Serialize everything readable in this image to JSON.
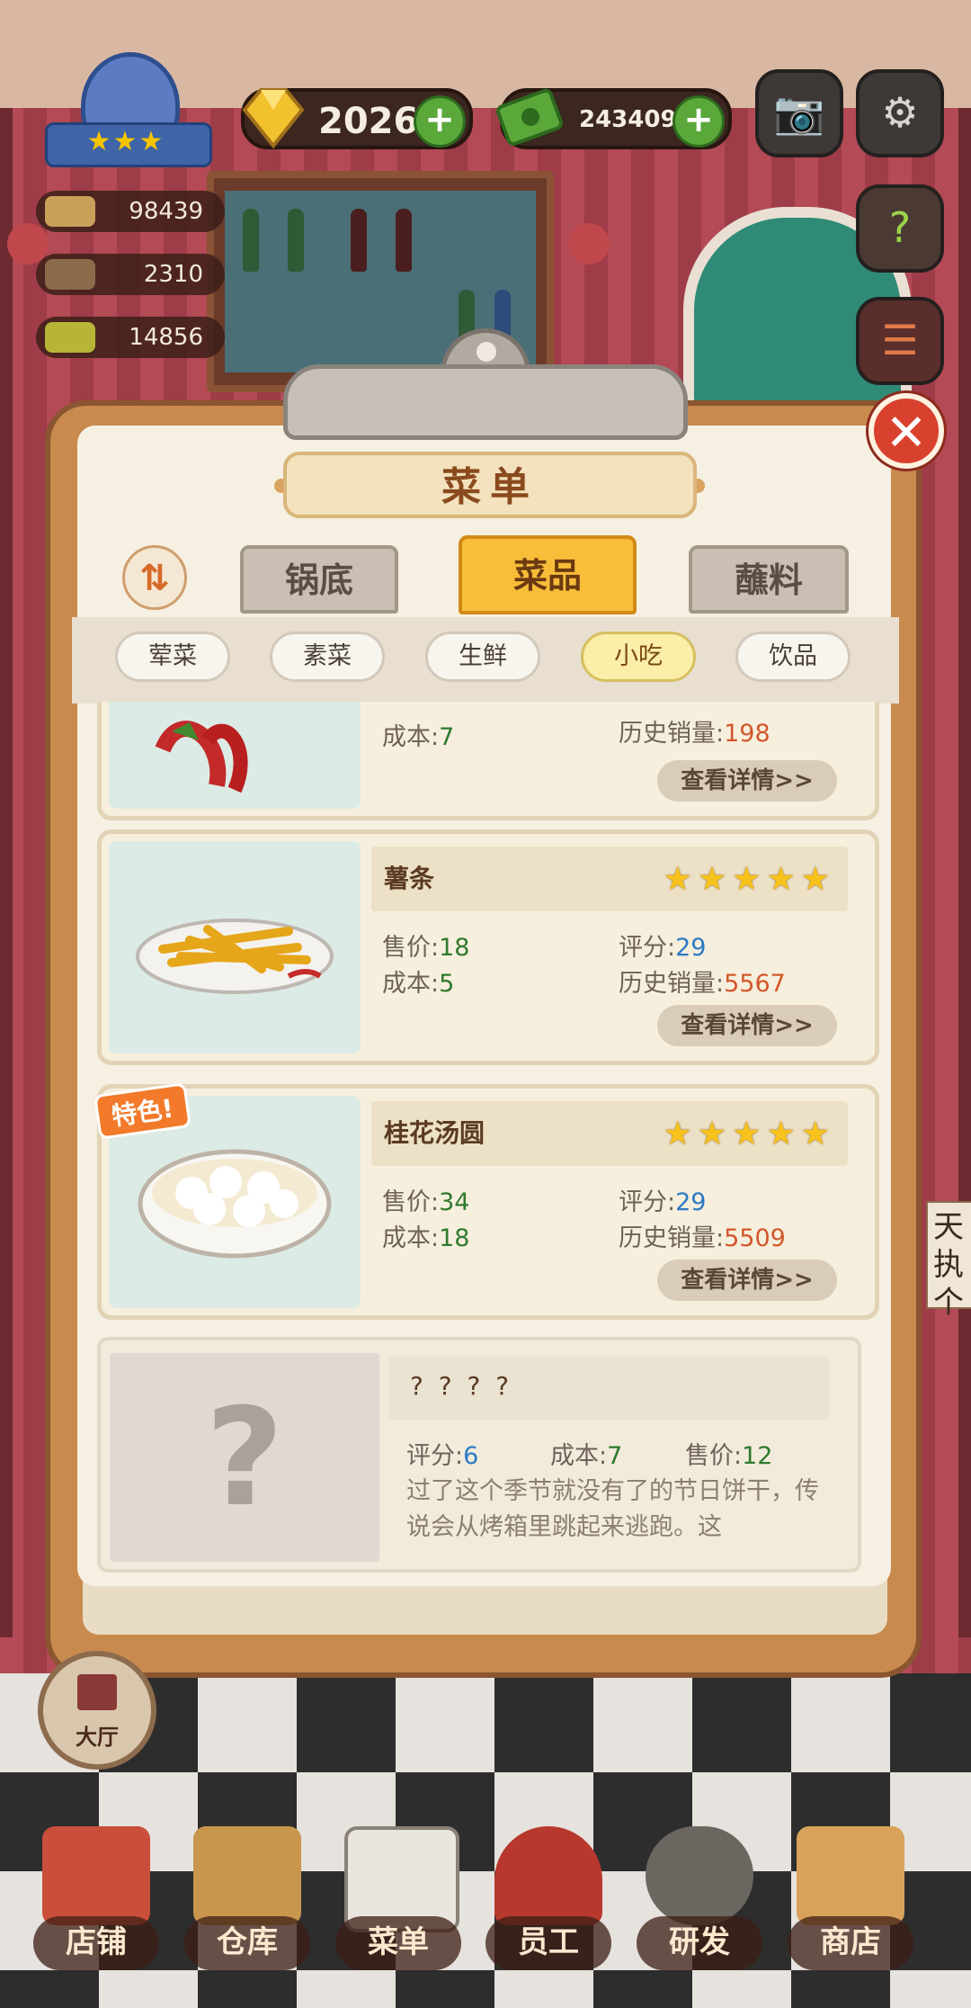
{
  "hud": {
    "gems": "2026",
    "cash": "24340991",
    "stat_1": "98439",
    "stat_2": "2310",
    "stat_3": "14856",
    "plus_symbol": "+",
    "level_stars": "★★★"
  },
  "icons": {
    "camera": "camera-icon",
    "settings": "gear-icon",
    "help": "help-book-icon",
    "recipe": "recipe-book-icon",
    "close": "close-icon",
    "sort": "sort-icon"
  },
  "menu": {
    "title": "菜单",
    "close_symbol": "✕",
    "sort_symbol": "⇅",
    "main_tabs": [
      {
        "label": "锅底",
        "active": false
      },
      {
        "label": "菜品",
        "active": true
      },
      {
        "label": "蘸料",
        "active": false
      }
    ],
    "sub_tabs": [
      {
        "label": "荤菜",
        "active": false
      },
      {
        "label": "素菜",
        "active": false
      },
      {
        "label": "生鲜",
        "active": false
      },
      {
        "label": "小吃",
        "active": true
      },
      {
        "label": "饮品",
        "active": false
      }
    ],
    "labels": {
      "price": "售价",
      "cost": "成本",
      "rating": "评分",
      "sales": "历史销量",
      "details": "查看详情>>",
      "sep": ":"
    },
    "dishes": [
      {
        "name": "",
        "price": "",
        "cost": "7",
        "rating": "",
        "sales": "198",
        "stars": 5,
        "special": false
      },
      {
        "name": "薯条",
        "price": "18",
        "cost": "5",
        "rating": "29",
        "sales": "5567",
        "stars": 5,
        "special": false
      },
      {
        "name": "桂花汤圆",
        "price": "34",
        "cost": "18",
        "rating": "29",
        "sales": "5509",
        "stars": 5,
        "special": true,
        "special_label": "特色!"
      }
    ],
    "locked": {
      "name": "? ? ? ?",
      "rating_label": "评分",
      "rating": "6",
      "cost_label": "成本",
      "cost": "7",
      "price_label": "售价",
      "price": "12",
      "q_mark": "?",
      "description": "过了这个季节就没有了的节日饼干，传说会从烤箱里跳起来逃跑。这"
    }
  },
  "hall_button": {
    "label": "大厅"
  },
  "side_note": {
    "text": "天执个"
  },
  "bottom_nav": [
    {
      "label": "店铺"
    },
    {
      "label": "仓库"
    },
    {
      "label": "菜单"
    },
    {
      "label": "员工"
    },
    {
      "label": "研发"
    },
    {
      "label": "商店"
    }
  ],
  "colors": {
    "active_tab": "#f8be3a",
    "board": "#c98a4e",
    "close_button": "#d9412f",
    "plus_button": "#5aa83a",
    "price_green": "#2f7a2e",
    "rating_blue": "#2d79c4",
    "sales_orange": "#d2572b"
  }
}
